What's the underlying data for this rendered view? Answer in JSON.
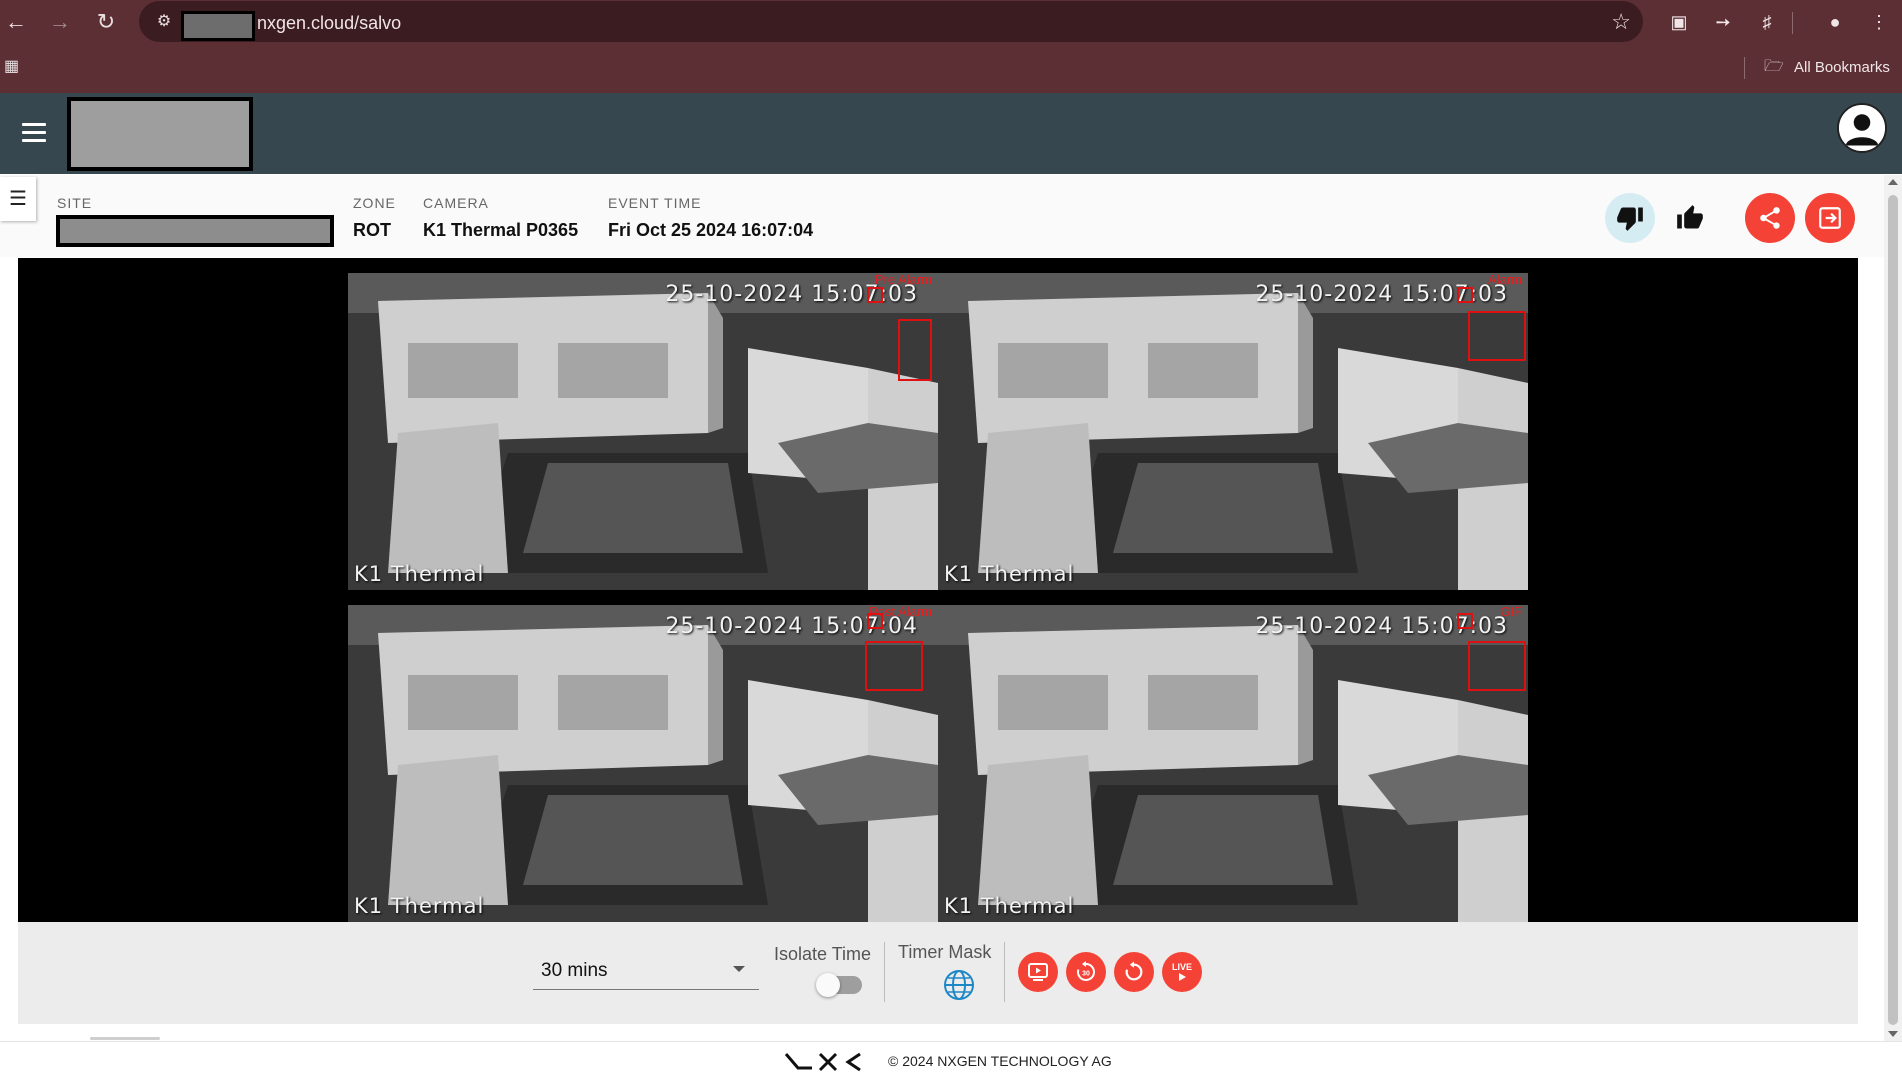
{
  "browser": {
    "url": "nxgen.cloud/salvo",
    "bookmarks_label": "All Bookmarks",
    "icons": [
      "back-arrow-icon",
      "forward-arrow-icon",
      "reload-icon",
      "site-info-icon",
      "bookmark-star-icon",
      "extension-icon",
      "puzzle-icon",
      "profile-icon",
      "kebab-menu-icon",
      "apps-grid-icon",
      "folder-icon"
    ]
  },
  "event": {
    "site_label": "SITE",
    "zone_label": "ZONE",
    "zone_value": "ROT",
    "camera_label": "CAMERA",
    "camera_value": "K1 Thermal P0365",
    "event_time_label": "EVENT TIME",
    "event_time_value": "Fri Oct 25 2024 16:07:04"
  },
  "tiles": [
    {
      "tag": "Pre Alarm",
      "timestamp": "25-10-2024 15:07:03",
      "camera": "K1 Thermal"
    },
    {
      "tag": "Alarm",
      "timestamp": "25-10-2024 15:07:03",
      "camera": "K1 Thermal"
    },
    {
      "tag": "Post Alarm",
      "timestamp": "25-10-2024 15:07:04",
      "camera": "K1 Thermal"
    },
    {
      "tag": "GIF",
      "timestamp": "25-10-2024 15:07:03",
      "camera": "K1 Thermal"
    }
  ],
  "controls": {
    "time_range_value": "30 mins",
    "isolate_time_label": "Isolate Time",
    "isolate_time_on": false,
    "timer_mask_label": "Timer Mask",
    "live_label": "LIVE",
    "replay_30_label": "30"
  },
  "colors": {
    "chrome": "#5c2f35",
    "header": "#37474f",
    "accent_red": "#f44336",
    "alarm_tag": "#e02020",
    "thumbs_down_bg": "#d6ecf3"
  },
  "footer": {
    "logo_text": "NXG",
    "copyright": "© 2024 NXGEN TECHNOLOGY AG"
  }
}
